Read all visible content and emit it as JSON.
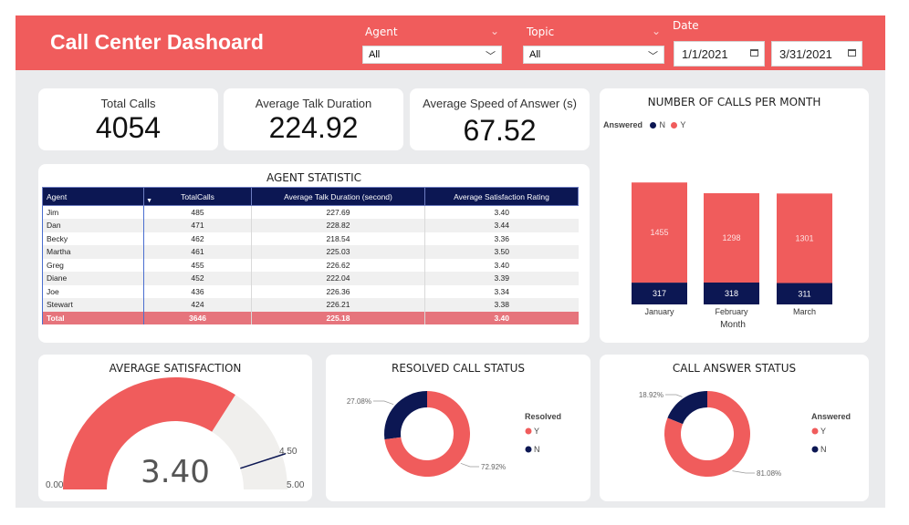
{
  "header": {
    "title": "Call Center Dashoard",
    "filters": {
      "agent": {
        "label": "Agent",
        "value": "All"
      },
      "topic": {
        "label": "Topic",
        "value": "All"
      },
      "date": {
        "label": "Date",
        "start": "1/1/2021",
        "end": "3/31/2021"
      }
    }
  },
  "kpis": [
    {
      "label": "Total Calls",
      "value": "4054"
    },
    {
      "label": "Average Talk Duration",
      "value": "224.92"
    },
    {
      "label": "Average Speed of Answer (s)",
      "value": "67.52"
    }
  ],
  "agent_table": {
    "title": "AGENT STATISTIC",
    "columns": [
      "Agent",
      "TotalCalls",
      "Average Talk Duration (second)",
      "Average Satisfaction Rating"
    ],
    "rows": [
      [
        "Jim",
        "485",
        "227.69",
        "3.40"
      ],
      [
        "Dan",
        "471",
        "228.82",
        "3.44"
      ],
      [
        "Becky",
        "462",
        "218.54",
        "3.36"
      ],
      [
        "Martha",
        "461",
        "225.03",
        "3.50"
      ],
      [
        "Greg",
        "455",
        "226.62",
        "3.40"
      ],
      [
        "Diane",
        "452",
        "222.04",
        "3.39"
      ],
      [
        "Joe",
        "436",
        "226.36",
        "3.34"
      ],
      [
        "Stewart",
        "424",
        "226.21",
        "3.38"
      ]
    ],
    "total": [
      "Total",
      "3646",
      "225.18",
      "3.40"
    ]
  },
  "chart_data": [
    {
      "type": "bar",
      "stacked": true,
      "title": "NUMBER OF CALLS PER MONTH",
      "legend_title": "Answered",
      "xlabel": "Month",
      "categories": [
        "January",
        "February",
        "March"
      ],
      "series": [
        {
          "name": "N",
          "color": "#0c1753",
          "values": [
            317,
            318,
            311
          ]
        },
        {
          "name": "Y",
          "color": "#f05c5c",
          "values": [
            1455,
            1298,
            1301
          ]
        }
      ]
    },
    {
      "type": "pie",
      "title": "RESOLVED CALL STATUS",
      "legend_title": "Resolved",
      "slices": [
        {
          "name": "Y",
          "value": 72.92,
          "label": "72.92%",
          "color": "#f05c5c"
        },
        {
          "name": "N",
          "value": 27.08,
          "label": "27.08%",
          "color": "#0c1753"
        }
      ]
    },
    {
      "type": "pie",
      "title": "CALL ANSWER STATUS",
      "legend_title": "Answered",
      "slices": [
        {
          "name": "Y",
          "value": 81.08,
          "label": "81.08%",
          "color": "#f05c5c"
        },
        {
          "name": "N",
          "value": 18.92,
          "label": "18.92%",
          "color": "#0c1753"
        }
      ]
    }
  ],
  "gauge": {
    "title": "AVERAGE SATISFACTION",
    "value": 3.4,
    "value_label": "3.40",
    "min": 0,
    "min_label": "0.00",
    "max": 5,
    "max_label": "5.00",
    "target": 4.5,
    "target_label": "4.50",
    "fill_color": "#f05c5c",
    "track_color": "#f0efed",
    "target_color": "#0c1753"
  }
}
